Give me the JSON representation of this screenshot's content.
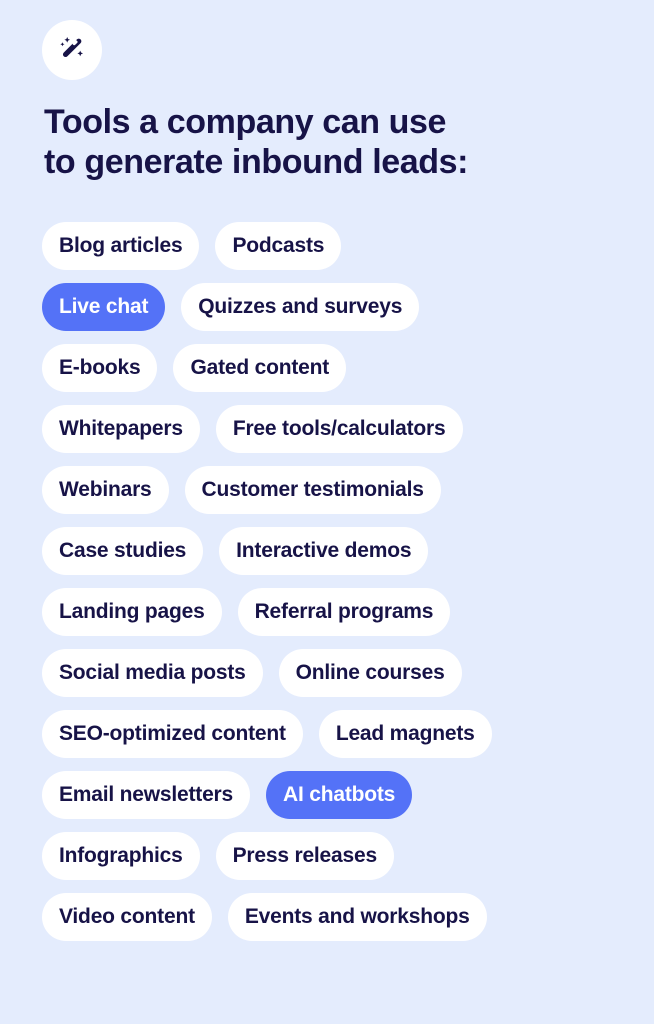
{
  "theme": {
    "background_color": "#e4ecfd",
    "pill_color": "#ffffff",
    "text_color": "#171347",
    "highlight_color": "#5472f7",
    "highlight_text_color": "#ffffff"
  },
  "badge": {
    "icon": "magic-wand-icon"
  },
  "header": {
    "title": "Tools a company can use\nto generate inbound leads:"
  },
  "tags": {
    "rows": [
      [
        {
          "label": "Blog articles",
          "highlighted": false
        },
        {
          "label": "Podcasts",
          "highlighted": false
        }
      ],
      [
        {
          "label": "Live chat",
          "highlighted": true
        },
        {
          "label": "Quizzes and surveys",
          "highlighted": false
        }
      ],
      [
        {
          "label": "E-books",
          "highlighted": false
        },
        {
          "label": "Gated content",
          "highlighted": false
        }
      ],
      [
        {
          "label": "Whitepapers",
          "highlighted": false
        },
        {
          "label": "Free tools/calculators",
          "highlighted": false
        }
      ],
      [
        {
          "label": "Webinars",
          "highlighted": false
        },
        {
          "label": "Customer testimonials",
          "highlighted": false
        }
      ],
      [
        {
          "label": "Case studies",
          "highlighted": false
        },
        {
          "label": "Interactive demos",
          "highlighted": false
        }
      ],
      [
        {
          "label": "Landing pages",
          "highlighted": false
        },
        {
          "label": "Referral programs",
          "highlighted": false
        }
      ],
      [
        {
          "label": "Social media posts",
          "highlighted": false
        },
        {
          "label": "Online courses",
          "highlighted": false
        }
      ],
      [
        {
          "label": "SEO-optimized content",
          "highlighted": false
        },
        {
          "label": "Lead magnets",
          "highlighted": false
        }
      ],
      [
        {
          "label": "Email newsletters",
          "highlighted": false
        },
        {
          "label": "AI chatbots",
          "highlighted": true
        }
      ],
      [
        {
          "label": "Infographics",
          "highlighted": false
        },
        {
          "label": "Press releases",
          "highlighted": false
        }
      ],
      [
        {
          "label": "Video content",
          "highlighted": false
        },
        {
          "label": "Events and workshops",
          "highlighted": false
        }
      ]
    ]
  }
}
